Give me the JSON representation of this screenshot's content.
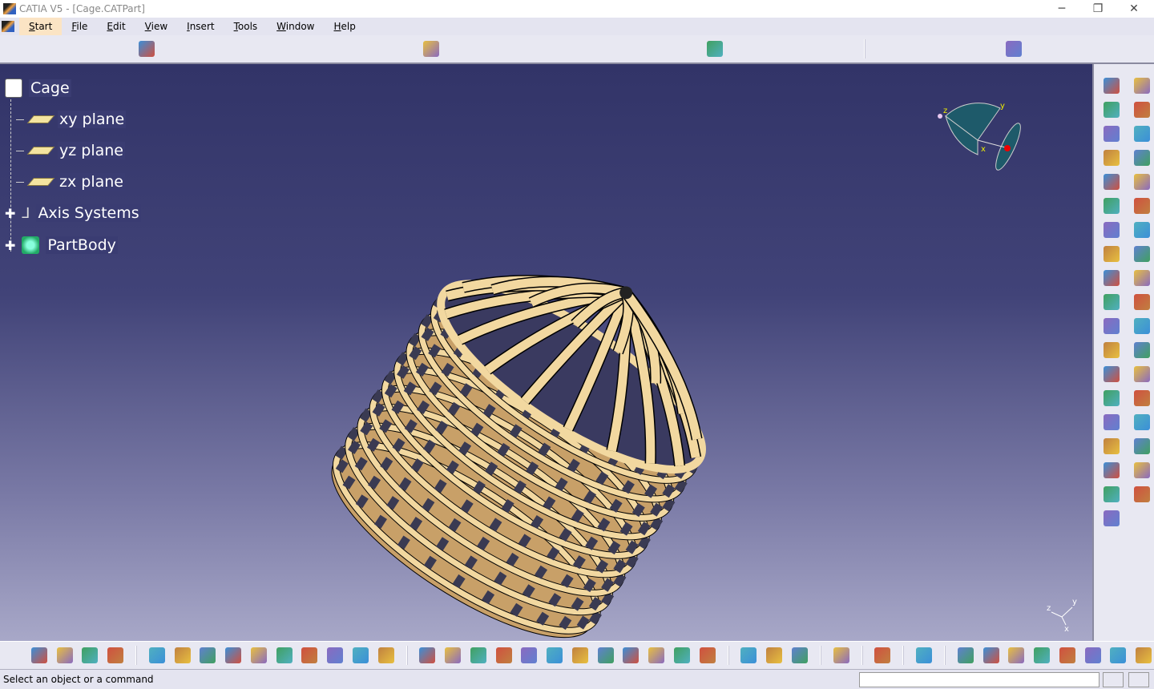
{
  "window": {
    "title": "CATIA V5 - [Cage.CATPart]",
    "minimize": "─",
    "restore": "❐",
    "close": "✕"
  },
  "menu": [
    "Start",
    "File",
    "Edit",
    "View",
    "Insert",
    "Tools",
    "Window",
    "Help"
  ],
  "toolbar_icons": [
    "envelope-icon",
    "multi-envelope-icon",
    "whats-this-icon",
    "|",
    "catalog-icon"
  ],
  "tree": {
    "root": "Cage",
    "items": [
      "xy plane",
      "yz plane",
      "zx plane",
      "Axis Systems",
      "PartBody"
    ]
  },
  "compass": {
    "x": "x",
    "y": "y",
    "z": "z"
  },
  "right_toolbar_icons": [
    "settings-icon",
    "select-icon",
    "sketch-icon",
    "sketch-plane-icon",
    "sketch-output-icon",
    "edit-sketch-icon",
    "pad-icon",
    "pocket-icon",
    "hole-icon",
    "rib-icon",
    "slot-icon",
    "stiffener-icon",
    "fillet-icon",
    "chamfer-icon",
    "draft-icon",
    "shell-icon",
    "thickness-icon",
    "thread-icon",
    "measure-icon",
    "apply-material-icon",
    "axis-icon",
    "grid-icon",
    "snap-icon",
    "point-icon",
    "point-icon-2",
    "line-icon",
    "plane-icon",
    "circle-icon",
    "boolean-icon",
    "add-icon",
    "remove-icon",
    "intersect-icon",
    "transform-icon",
    "mirror-icon",
    "pattern-icon",
    "scale-icon",
    "constraint-icon"
  ],
  "bottom_toolbar_icons": [
    "shape-icon",
    "surface-icon",
    "analysis-icon",
    "layers-icon",
    "|",
    "new-icon",
    "open-icon",
    "save-icon",
    "print-icon",
    "cut-icon",
    "copy-icon",
    "paste-icon",
    "undo-icon",
    "redo-icon",
    "help-icon",
    "|",
    "fly-icon",
    "fit-all-icon",
    "pan-icon",
    "rotate-icon",
    "zoom-in-icon",
    "zoom-out-icon",
    "normal-view-icon",
    "multi-view-icon",
    "iso-view-icon",
    "shading-icon",
    "hide-show-icon",
    "swap-icon",
    "|",
    "measure-between-icon",
    "measure-item-icon",
    "inertia-icon",
    "|",
    "capture-icon",
    "|",
    "tree-icon",
    "|",
    "material-icon",
    "|",
    "update-icon",
    "hand-icon",
    "axis-system-icon",
    "units-icon",
    "parameters-icon",
    "formula-icon",
    "list-icon",
    "plane-tool-icon"
  ],
  "status": {
    "text": "Select an object or a command"
  },
  "colors": {
    "part": "#f2d8a0",
    "background_top": "#323468",
    "background_bottom": "#a8a8c8"
  }
}
